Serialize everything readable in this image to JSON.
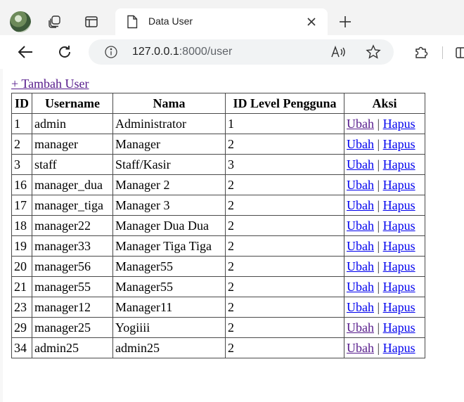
{
  "browser": {
    "tab_title": "Data User",
    "url_host": "127.0.0.1",
    "url_rest": ":8000/user"
  },
  "page": {
    "add_link": "+ Tambah User",
    "table": {
      "headers": [
        "ID",
        "Username",
        "Nama",
        "ID Level Pengguna",
        "Aksi"
      ],
      "edit_label": "Ubah",
      "separator": "|",
      "delete_label": "Hapus",
      "rows": [
        {
          "id": "1",
          "username": "admin",
          "nama": "Administrator",
          "level": "1",
          "edit_visited": true
        },
        {
          "id": "2",
          "username": "manager",
          "nama": "Manager",
          "level": "2",
          "edit_visited": false
        },
        {
          "id": "3",
          "username": "staff",
          "nama": "Staff/Kasir",
          "level": "3",
          "edit_visited": false
        },
        {
          "id": "16",
          "username": "manager_dua",
          "nama": "Manager 2",
          "level": "2",
          "edit_visited": false
        },
        {
          "id": "17",
          "username": "manager_tiga",
          "nama": "Manager 3",
          "level": "2",
          "edit_visited": false
        },
        {
          "id": "18",
          "username": "manager22",
          "nama": "Manager Dua Dua",
          "level": "2",
          "edit_visited": false
        },
        {
          "id": "19",
          "username": "manager33",
          "nama": "Manager Tiga Tiga",
          "level": "2",
          "edit_visited": false
        },
        {
          "id": "20",
          "username": "manager56",
          "nama": "Manager55",
          "level": "2",
          "edit_visited": false
        },
        {
          "id": "21",
          "username": "manager55",
          "nama": "Manager55",
          "level": "2",
          "edit_visited": false
        },
        {
          "id": "23",
          "username": "manager12",
          "nama": "Manager11",
          "level": "2",
          "edit_visited": false
        },
        {
          "id": "29",
          "username": "manager25",
          "nama": "Yogiiii",
          "level": "2",
          "edit_visited": true
        },
        {
          "id": "34",
          "username": "admin25",
          "nama": "admin25",
          "level": "2",
          "edit_visited": true
        }
      ]
    }
  }
}
